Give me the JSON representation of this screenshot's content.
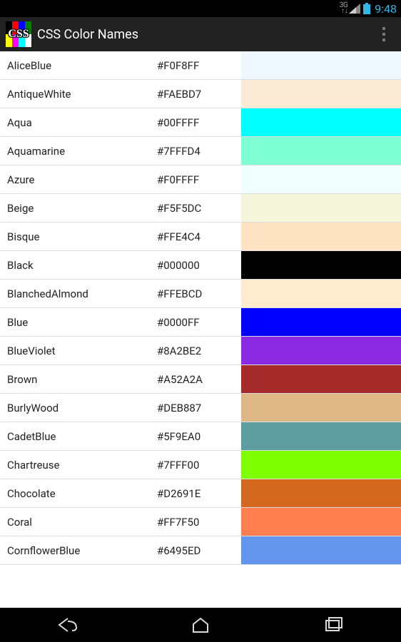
{
  "status": {
    "time": "9:48",
    "net_label": "3G"
  },
  "action_bar": {
    "title": "CSS Color Names",
    "icon_text": "CSS"
  },
  "colors": [
    {
      "name": "AliceBlue",
      "hex": "#F0F8FF"
    },
    {
      "name": "AntiqueWhite",
      "hex": "#FAEBD7"
    },
    {
      "name": "Aqua",
      "hex": "#00FFFF"
    },
    {
      "name": "Aquamarine",
      "hex": "#7FFFD4"
    },
    {
      "name": "Azure",
      "hex": "#F0FFFF"
    },
    {
      "name": "Beige",
      "hex": "#F5F5DC"
    },
    {
      "name": "Bisque",
      "hex": "#FFE4C4"
    },
    {
      "name": "Black",
      "hex": "#000000"
    },
    {
      "name": "BlanchedAlmond",
      "hex": "#FFEBCD"
    },
    {
      "name": "Blue",
      "hex": "#0000FF"
    },
    {
      "name": "BlueViolet",
      "hex": "#8A2BE2"
    },
    {
      "name": "Brown",
      "hex": "#A52A2A"
    },
    {
      "name": "BurlyWood",
      "hex": "#DEB887"
    },
    {
      "name": "CadetBlue",
      "hex": "#5F9EA0"
    },
    {
      "name": "Chartreuse",
      "hex": "#7FFF00"
    },
    {
      "name": "Chocolate",
      "hex": "#D2691E"
    },
    {
      "name": "Coral",
      "hex": "#FF7F50"
    },
    {
      "name": "CornflowerBlue",
      "hex": "#6495ED"
    }
  ]
}
